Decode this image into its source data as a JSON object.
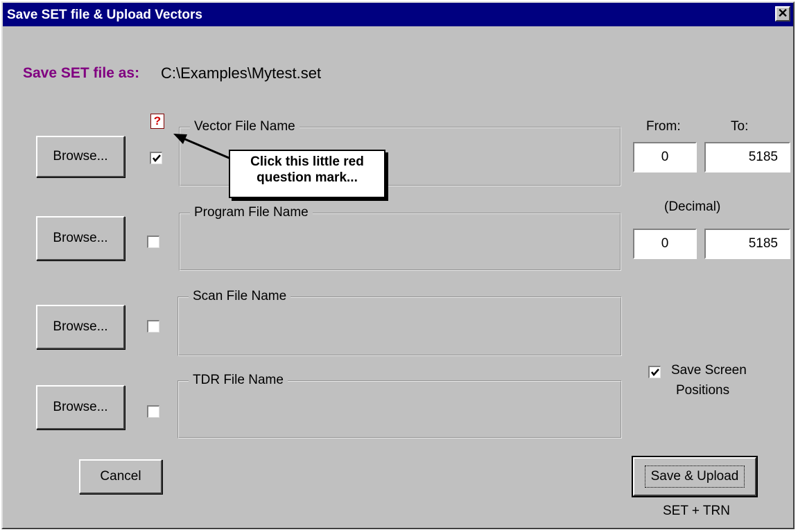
{
  "window": {
    "title": "Save SET file & Upload Vectors",
    "close_glyph": "✕"
  },
  "save_as": {
    "label": "Save SET file as:",
    "path": "C:\\Examples\\Mytest.set"
  },
  "rows": [
    {
      "browse_label": "Browse...",
      "checked": true,
      "group_label": "Vector File Name"
    },
    {
      "browse_label": "Browse...",
      "checked": false,
      "group_label": "Program File Name"
    },
    {
      "browse_label": "Browse...",
      "checked": false,
      "group_label": "Scan File Name"
    },
    {
      "browse_label": "Browse...",
      "checked": false,
      "group_label": "TDR File Name"
    }
  ],
  "range": {
    "from_label": "From:",
    "to_label": "To:",
    "decimal_label": "(Decimal)",
    "row1": {
      "from": "0",
      "to": "5185"
    },
    "row2": {
      "from": "0",
      "to": "5185"
    }
  },
  "help": {
    "glyph": "?",
    "callout_text": "Click this little red question mark..."
  },
  "save_screen": {
    "checked": true,
    "label_line1": "Save Screen",
    "label_line2": "Positions"
  },
  "actions": {
    "cancel_label": "Cancel",
    "save_upload_label": "Save & Upload",
    "save_upload_caption": "SET + TRN"
  },
  "colors": {
    "titlebar": "#000080",
    "dialog_bg": "#c0c0c0",
    "save_as_label": "#800080",
    "help_mark": "#d00000"
  }
}
